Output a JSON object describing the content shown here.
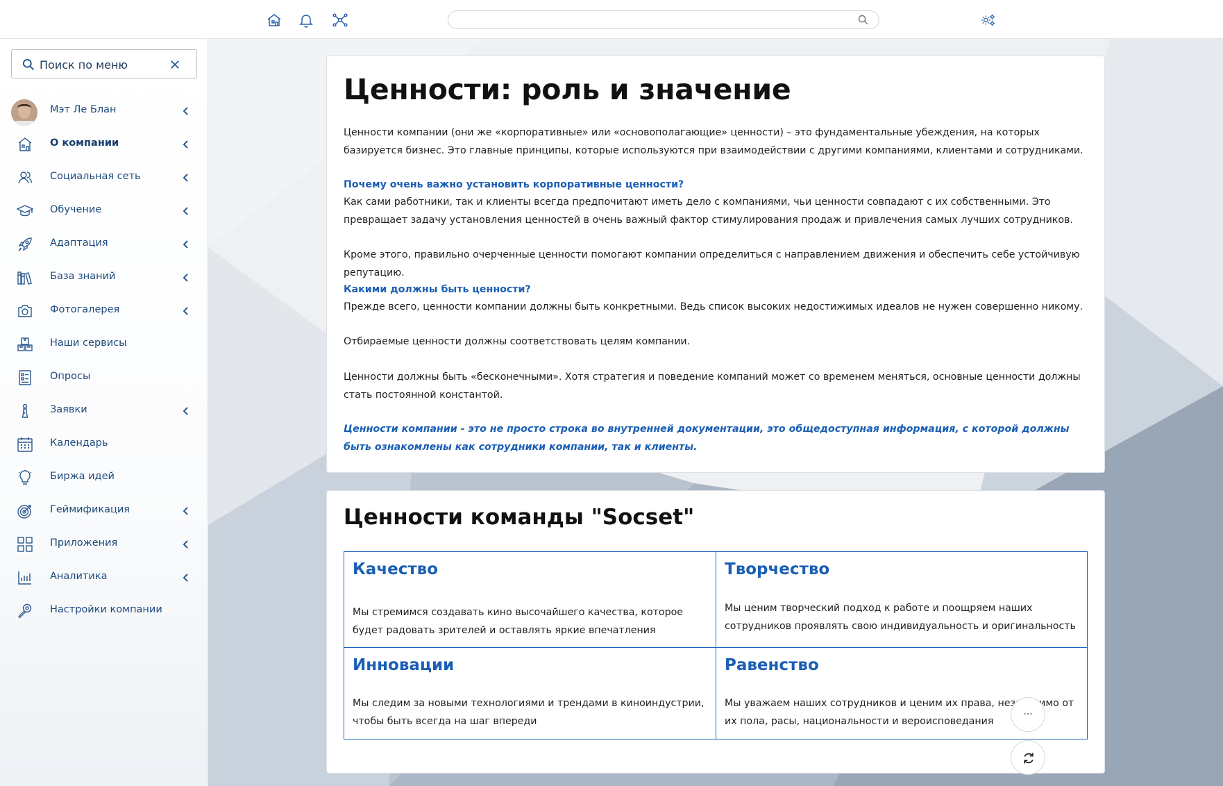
{
  "topbar": {
    "icons": [
      "home-icon",
      "bell-icon",
      "network-icon",
      "settings-gears-icon"
    ],
    "search": {
      "placeholder": "",
      "value": ""
    }
  },
  "sidebar": {
    "search": {
      "placeholder": "Поиск по меню"
    },
    "user": {
      "name": "Мэт Ле Блан"
    },
    "items": [
      {
        "label": "О компании",
        "icon": "building-icon",
        "has_submenu": true,
        "active": true
      },
      {
        "label": "Социальная сеть",
        "icon": "users-icon",
        "has_submenu": true
      },
      {
        "label": "Обучение",
        "icon": "graduation-cap-icon",
        "has_submenu": true
      },
      {
        "label": "Адаптация",
        "icon": "rocket-icon",
        "has_submenu": true
      },
      {
        "label": "База знаний",
        "icon": "books-icon",
        "has_submenu": true
      },
      {
        "label": "Фотогалерея",
        "icon": "camera-icon",
        "has_submenu": true
      },
      {
        "label": "Наши сервисы",
        "icon": "boxes-icon",
        "has_submenu": false
      },
      {
        "label": "Опросы",
        "icon": "survey-list-icon",
        "has_submenu": false
      },
      {
        "label": "Заявки",
        "icon": "request-icon",
        "has_submenu": true
      },
      {
        "label": "Календарь",
        "icon": "calendar-icon",
        "has_submenu": false
      },
      {
        "label": "Биржа идей",
        "icon": "lightbulb-icon",
        "has_submenu": false
      },
      {
        "label": "Геймификация",
        "icon": "target-icon",
        "has_submenu": true
      },
      {
        "label": "Приложения",
        "icon": "apps-grid-icon",
        "has_submenu": true
      },
      {
        "label": "Аналитика",
        "icon": "bar-chart-icon",
        "has_submenu": true
      },
      {
        "label": "Настройки компании",
        "icon": "wrench-icon",
        "has_submenu": false
      }
    ]
  },
  "article": {
    "title": "Ценности: роль и значение",
    "intro": "Ценности компании (они же «корпоративные» или «основополагающие» ценности) – это фундаментальные убеждения, на которых базируется бизнес. Это главные принципы, которые используются при взаимодействии с другими компаниями, клиентами и сотрудниками.",
    "q1": "Почему очень важно установить корпоративные ценности?",
    "a1": "Как сами работники, так и клиенты всегда предпочитают иметь дело с компаниями, чьи ценности совпадают с их собственными. Это превращает задачу установления ценностей в очень важный фактор стимулирования продаж и привлечения самых лучших сотрудников.",
    "a1b": "Кроме этого, правильно очерченные ценности помогают компании определиться с направлением движения и обеспечить себе устойчивую репутацию.",
    "q2": "Какими должны быть ценности?",
    "a2": "Прежде всего, ценности компании должны быть конкретными. Ведь список высоких недостижимых идеалов не нужен совершенно никому.",
    "a2b": "Отбираемые ценности должны соответствовать целям компании.",
    "a2c": "Ценности должны быть «бесконечными». Хотя стратегия и поведение компаний может со временем меняться, основные ценности должны стать постоянной константой.",
    "note": "Ценности компании - это не просто строка во внутренней документации, это общедоступная информация, с которой должны быть ознакомлены как сотрудники компании, так и клиенты."
  },
  "values": {
    "title": "Ценности команды \"Socset\"",
    "items": [
      {
        "title": "Качество",
        "text": "Мы стремимся создавать кино высочайшего качества, которое будет радовать зрителей и оставлять яркие впечатления"
      },
      {
        "title": "Творчество",
        "text": "Мы ценим творческий подход к работе и поощряем наших сотрудников проявлять свою индивидуальность и оригинальность"
      },
      {
        "title": "Инновации",
        "text": "Мы следим за новыми технологиями и трендами в киноиндустрии, чтобы быть всегда на шаг впереди"
      },
      {
        "title": "Равенство",
        "text": "Мы уважаем наших сотрудников и ценим их права, независимо от их пола, расы, национальности и вероисповедания"
      }
    ]
  },
  "fabs": {
    "more_label": "...",
    "refresh_icon": "refresh-icon"
  },
  "colors": {
    "accent": "#1b5fb4",
    "sidebar_text": "#1e4a7c",
    "border": "#1b64c2"
  }
}
